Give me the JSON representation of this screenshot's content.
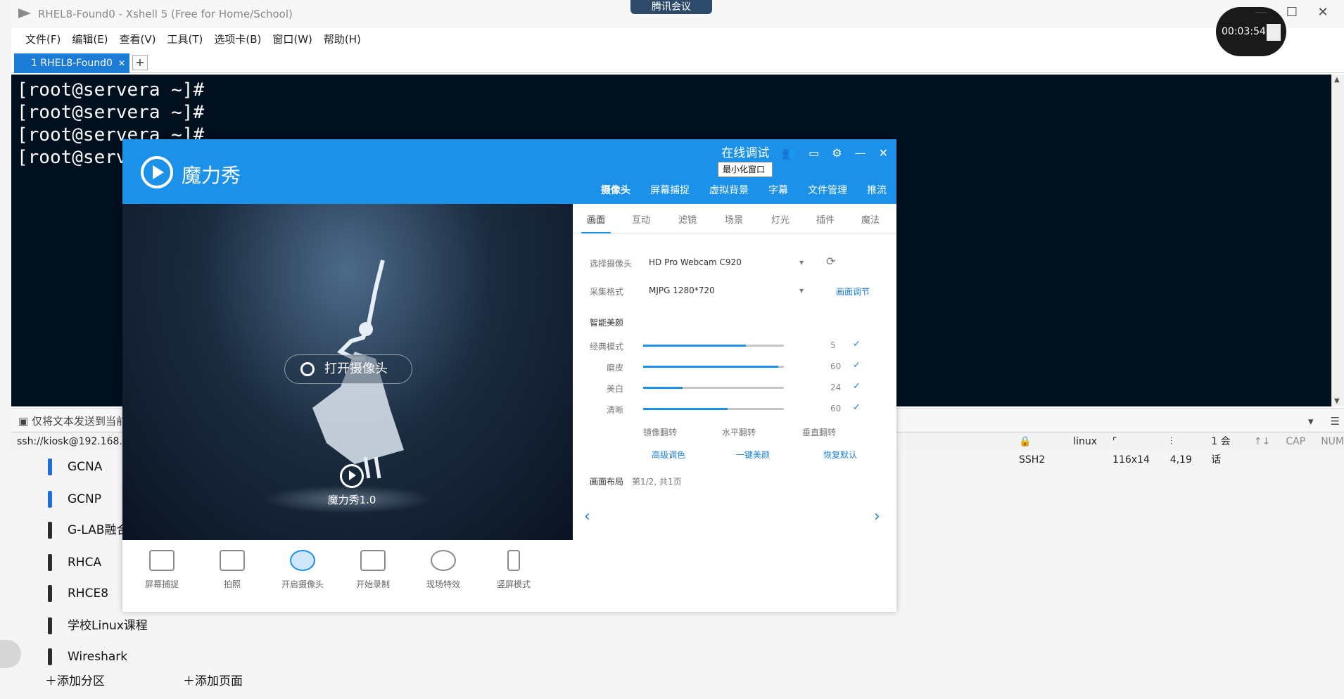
{
  "meeting_label": "腾讯会议",
  "recording_timer": "00:03:54",
  "xshell": {
    "title": "RHEL8-Found0 - Xshell 5 (Free for Home/School)",
    "menu": [
      "文件(F)",
      "编辑(E)",
      "查看(V)",
      "工具(T)",
      "选项卡(B)",
      "窗口(W)",
      "帮助(H)"
    ],
    "tab_label": "1 RHEL8-Found0",
    "terminal_lines": [
      "[root@servera ~]#",
      "[root@servera ~]#",
      "[root@servera ~]#",
      "[root@serv"
    ],
    "compose_text": "仅将文本发送到当前",
    "status": {
      "ssh": "ssh://kiosk@192.168.15",
      "protocol": "SSH2",
      "term": "linux",
      "size": "116x14",
      "cursor": "4,19",
      "sessions": "1 会话",
      "cap": "CAP",
      "num": "NUM"
    }
  },
  "sections": [
    "GCNA",
    "GCNP",
    "G-LAB融合",
    "RHCA",
    "RHCE8",
    "学校Linux课程",
    "Wireshark"
  ],
  "add_actions": {
    "section": "添加分区",
    "page": "添加页面"
  },
  "mlx": {
    "title": "魔力秀",
    "online_debug": "在线调试",
    "tooltip": "最小化窗口",
    "nav": [
      "摄像头",
      "屏幕捕捉",
      "虚拟背景",
      "字幕",
      "文件管理",
      "推流"
    ],
    "open_camera": "打开摄像头",
    "brand_version": "魔力秀1.0",
    "tools": [
      "屏幕捕捉",
      "拍照",
      "开启摄像头",
      "开始录制",
      "现场特效",
      "竖屏模式"
    ],
    "subtabs": [
      "画面",
      "互动",
      "滤镜",
      "场景",
      "灯光",
      "插件",
      "魔法"
    ],
    "select_camera_label": "选择摄像头",
    "camera": "HD Pro Webcam C920",
    "format_label": "采集格式",
    "format": "MJPG 1280*720",
    "adjust_link": "画面调节",
    "beauty_label": "智能美颜",
    "sliders": [
      {
        "label": "经典模式",
        "value": 5,
        "fraction": 0.73
      },
      {
        "label": "磨皮",
        "value": 60,
        "fraction": 0.96
      },
      {
        "label": "美白",
        "value": 24,
        "fraction": 0.28
      },
      {
        "label": "清晰",
        "value": 60,
        "fraction": 0.6
      }
    ],
    "mirror_h": "镜像翻转",
    "mirror_lr": "水平翻转",
    "mirror_v": "垂直翻转",
    "advanced": "高级调色",
    "one_key": "一键美颜",
    "reset": "恢复默认",
    "layout_label": "画面布局",
    "layout_value": "第1/2, 共1页"
  }
}
